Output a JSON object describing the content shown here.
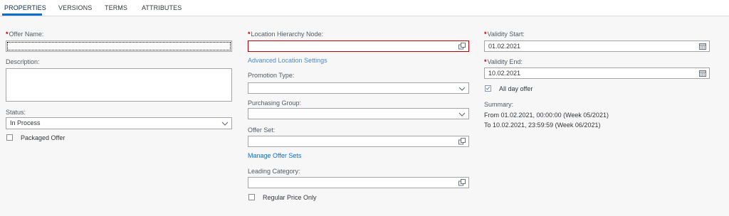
{
  "tabs": [
    {
      "label": "PROPERTIES",
      "active": true
    },
    {
      "label": "VERSIONS",
      "active": false
    },
    {
      "label": "TERMS",
      "active": false
    },
    {
      "label": "ATTRIBUTES",
      "active": false
    }
  ],
  "left": {
    "offer_name_label": "Offer Name:",
    "offer_name_value": "",
    "description_label": "Description:",
    "description_value": "",
    "status_label": "Status:",
    "status_value": "In Process",
    "packaged_offer_label": "Packaged Offer",
    "packaged_offer_checked": false
  },
  "middle": {
    "location_label": "Location Hierarchy Node:",
    "location_value": "",
    "advanced_location_link": "Advanced Location Settings",
    "promotion_type_label": "Promotion Type:",
    "promotion_type_value": "",
    "purchasing_group_label": "Purchasing Group:",
    "purchasing_group_value": "",
    "offer_set_label": "Offer Set:",
    "offer_set_value": "",
    "manage_offer_sets_link": "Manage Offer Sets",
    "leading_category_label": "Leading Category:",
    "leading_category_value": "",
    "regular_price_only_label": "Regular Price Only",
    "regular_price_only_checked": false
  },
  "right": {
    "validity_start_label": "Validity Start:",
    "validity_start_value": "01.02.2021",
    "validity_end_label": "Validity End:",
    "validity_end_value": "10.02.2021",
    "all_day_offer_label": "All day offer",
    "all_day_offer_checked": true,
    "summary_label": "Summary:",
    "summary_line1": "From 01.02.2021, 00:00:00 (Week 05/2021)",
    "summary_line2": "To 10.02.2021, 23:59:59 (Week 06/2021)"
  },
  "colors": {
    "accent": "#0a6ed1",
    "required": "#bb0000",
    "error_border": "#bb0000"
  }
}
